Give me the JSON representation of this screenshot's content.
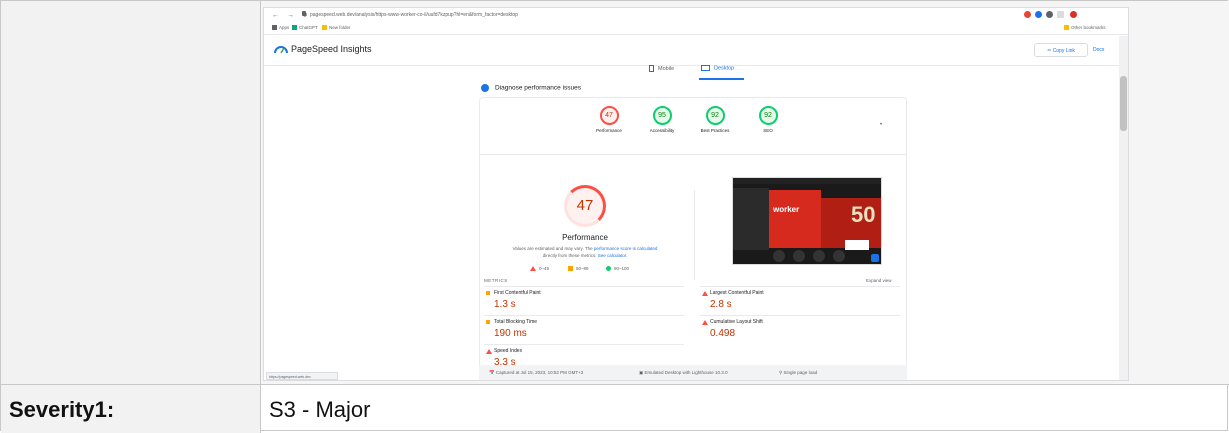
{
  "browser": {
    "url": "pagespeed.web.dev/analysis/https-www-worker-co-il/uufd7kzpup?hl=en&form_factor=desktop",
    "bookmarks": [
      "Apps",
      "ChatGPT",
      "New folder"
    ],
    "other_bookmarks": "Other bookmarks"
  },
  "psi": {
    "title": "PageSpeed Insights",
    "copy_link": "Copy Link",
    "docs": "Docs",
    "tab_mobile": "Mobile",
    "tab_desktop": "Desktop",
    "diagnose": "Diagnose performance issues",
    "categories": [
      {
        "score": "47",
        "label": "Performance",
        "status": "red"
      },
      {
        "score": "95",
        "label": "Accessibility",
        "status": "green"
      },
      {
        "score": "92",
        "label": "Best Practices",
        "status": "green"
      },
      {
        "score": "92",
        "label": "SEO",
        "status": "green"
      }
    ],
    "main_score": "47",
    "main_label": "Performance",
    "note_pre": "Values are estimated and may vary. The",
    "note_link1": "performance score is calculated",
    "note_mid": "directly from these metrics.",
    "note_link2": "See calculator.",
    "legend": [
      "0–49",
      "50–89",
      "90–100"
    ],
    "screenshot_logo": "worker",
    "screenshot_promo": "50",
    "metrics_header": "METRICS",
    "expand_view": "Expand view",
    "metrics": [
      {
        "name": "First Contentful Paint",
        "value": "1.3 s",
        "rating": "average"
      },
      {
        "name": "Largest Contentful Paint",
        "value": "2.8 s",
        "rating": "fail"
      },
      {
        "name": "Total Blocking Time",
        "value": "190 ms",
        "rating": "average"
      },
      {
        "name": "Cumulative Layout Shift",
        "value": "0.498",
        "rating": "fail"
      },
      {
        "name": "Speed Index",
        "value": "3.3 s",
        "rating": "fail"
      }
    ],
    "footer": {
      "captured": "Captured at Jul 15, 2023, 10:52 PM GMT+3",
      "emulated": "Emulated Desktop with Lighthouse 10.3.0",
      "load": "Single page load"
    },
    "status_url": "https://pagespeed.web.dev"
  },
  "severity": {
    "label": "Severity1:",
    "value": "S3 - Major"
  },
  "colors": {
    "fail": "#ff4e42",
    "average": "#ffa400",
    "pass": "#0cce6b",
    "accent": "#1a73e8"
  }
}
